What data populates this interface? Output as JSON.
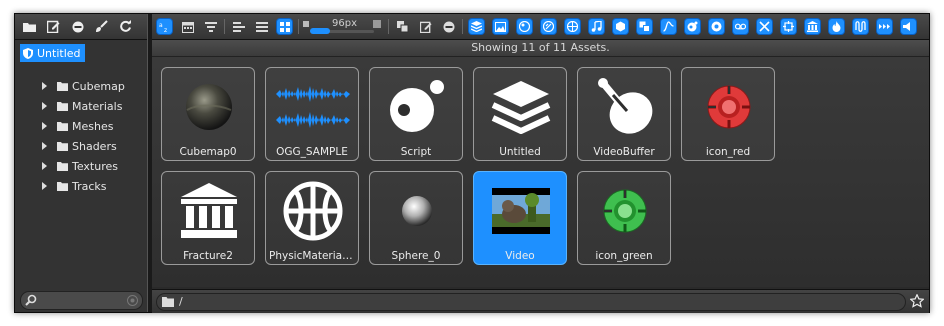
{
  "left_toolbar": {
    "icons": [
      "folder-icon",
      "edit-icon",
      "minus-circle-icon",
      "brush-icon",
      "refresh-icon"
    ]
  },
  "tree": {
    "root_label": "Untitled",
    "items": [
      "Cubemap",
      "Materials",
      "Meshes",
      "Shaders",
      "Textures",
      "Tracks"
    ]
  },
  "toolbar": {
    "size_label": "96px"
  },
  "status_text": "Showing 11 of 11 Assets.",
  "assets": [
    {
      "label": "Cubemap0",
      "icon": "sphere-dark-icon"
    },
    {
      "label": "OGG_SAMPLE",
      "icon": "waveform-icon"
    },
    {
      "label": "Script",
      "icon": "script-icon"
    },
    {
      "label": "Untitled",
      "icon": "layers-icon"
    },
    {
      "label": "VideoBuffer",
      "icon": "video-buffer-icon"
    },
    {
      "label": "icon_red",
      "icon": "red-ring-icon"
    },
    {
      "label": "Fracture2",
      "icon": "building-icon"
    },
    {
      "label": "PhysicMaterial...",
      "icon": "basketball-icon"
    },
    {
      "label": "Sphere_0",
      "icon": "sphere-light-icon"
    },
    {
      "label": "Video",
      "icon": "video-thumbnail-icon"
    },
    {
      "label": "icon_green",
      "icon": "green-ring-icon"
    }
  ],
  "path_text": "/",
  "colors": {
    "accent": "#1e90ff",
    "selected_tile": "#1e90ff"
  }
}
